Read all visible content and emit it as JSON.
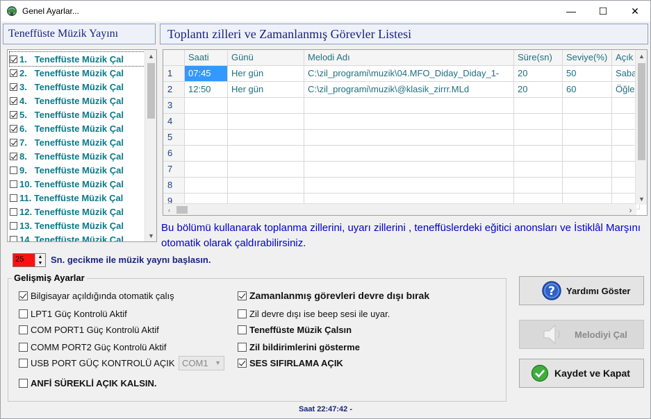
{
  "window": {
    "title": "Genel Ayarlar...",
    "minimize_glyph": "—",
    "maximize_glyph": "☐",
    "close_glyph": "✕"
  },
  "left_panel": {
    "title": "Teneffüste  Müzik Yayını",
    "items": [
      {
        "label": "1.   Teneffüste Müzik Çal",
        "checked": true
      },
      {
        "label": "2.   Teneffüste Müzik Çal",
        "checked": true
      },
      {
        "label": "3.   Teneffüste Müzik Çal",
        "checked": true
      },
      {
        "label": "4.   Teneffüste Müzik Çal",
        "checked": true
      },
      {
        "label": "5.   Teneffüste Müzik Çal",
        "checked": true
      },
      {
        "label": "6.   Teneffüste Müzik Çal",
        "checked": true
      },
      {
        "label": "7.   Teneffüste Müzik Çal",
        "checked": true
      },
      {
        "label": "8.   Teneffüste Müzik Çal",
        "checked": true
      },
      {
        "label": "9.   Teneffüste Müzik Çal",
        "checked": false
      },
      {
        "label": "10. Teneffüste Müzik Çal",
        "checked": false
      },
      {
        "label": "11. Teneffüste Müzik Çal",
        "checked": false
      },
      {
        "label": "12. Teneffüste Müzik Çal",
        "checked": false
      },
      {
        "label": "13. Teneffüste Müzik Çal",
        "checked": false
      },
      {
        "label": "14. Teneffüste Müzik Çal",
        "checked": false
      }
    ]
  },
  "right_panel": {
    "title": "Toplantı zilleri ve Zamanlanmış Görevler Listesi",
    "columns": [
      "",
      "Saati",
      "Günü",
      "Melodi Adı",
      "Süre(sn)",
      "Seviye(%)",
      "Açık"
    ],
    "rows": [
      {
        "num": "1",
        "saati": "07:45",
        "gunu": "Her gün",
        "melodi": "C:\\zil_programi\\muzik\\04.MFO_Diday_Diday_1-",
        "sure": "20",
        "seviye": "50",
        "aciklama": "Saba"
      },
      {
        "num": "2",
        "saati": "12:50",
        "gunu": "Her gün",
        "melodi": "C:\\zil_programi\\muzik\\@klasik_zirrr.MLd",
        "sure": "20",
        "seviye": "60",
        "aciklama": "Öğle"
      },
      {
        "num": "3",
        "saati": "",
        "gunu": "",
        "melodi": "",
        "sure": "",
        "seviye": "",
        "aciklama": ""
      },
      {
        "num": "4",
        "saati": "",
        "gunu": "",
        "melodi": "",
        "sure": "",
        "seviye": "",
        "aciklama": ""
      },
      {
        "num": "5",
        "saati": "",
        "gunu": "",
        "melodi": "",
        "sure": "",
        "seviye": "",
        "aciklama": ""
      },
      {
        "num": "6",
        "saati": "",
        "gunu": "",
        "melodi": "",
        "sure": "",
        "seviye": "",
        "aciklama": ""
      },
      {
        "num": "7",
        "saati": "",
        "gunu": "",
        "melodi": "",
        "sure": "",
        "seviye": "",
        "aciklama": ""
      },
      {
        "num": "8",
        "saati": "",
        "gunu": "",
        "melodi": "",
        "sure": "",
        "seviye": "",
        "aciklama": ""
      },
      {
        "num": "9",
        "saati": "",
        "gunu": "",
        "melodi": "",
        "sure": "",
        "seviye": "",
        "aciklama": ""
      }
    ],
    "info_text": "Bu bölümü kullanarak toplanma zillerini, uyarı zillerini , teneffüslerdeki eğitici anonsları ve İstiklâl Marşını otomatik olarak çaldırabilirsiniz."
  },
  "delay": {
    "value": "25",
    "label": "Sn. gecikme ile müzik yaynı başlasın."
  },
  "advanced": {
    "title": "Gelişmiş Ayarlar",
    "left_options": [
      {
        "label": "Bilgisayar açıldığında otomatik çalış",
        "checked": true
      },
      {
        "label": "LPT1 Güç Kontrolü Aktif",
        "checked": false
      },
      {
        "label": "COM PORT1 Güç Kontrolü Aktif",
        "checked": false
      },
      {
        "label": "COMM PORT2 Güç Kontrolü Aktif",
        "checked": false
      },
      {
        "label": "USB PORT GÜÇ KONTROLÜ AÇIK",
        "checked": false
      },
      {
        "label": "ANFİ SÜREKLİ AÇIK KALSIN.",
        "checked": false
      }
    ],
    "right_options": [
      {
        "label": "Zamanlanmış görevleri devre dışı bırak",
        "checked": true
      },
      {
        "label": "Zil devre dışı ise beep sesi ile uyar.",
        "checked": false
      },
      {
        "label": "Teneffüste Müzik Çalsın",
        "checked": false
      },
      {
        "label": "Zil bildirimlerini gösterme",
        "checked": false
      },
      {
        "label": "SES SIFIRLAMA AÇIK",
        "checked": true
      }
    ],
    "com_port": "COM1"
  },
  "buttons": {
    "help": "Yardımı Göster",
    "play": "Melodiyi Çal",
    "save": "Kaydet ve Kapat"
  },
  "status": "Saat  22:47:42  -",
  "colors": {
    "accent_teal": "#0a7a8a",
    "info_blue": "#0000cc",
    "selection": "#3399ff",
    "spin_red": "#ff1010"
  }
}
